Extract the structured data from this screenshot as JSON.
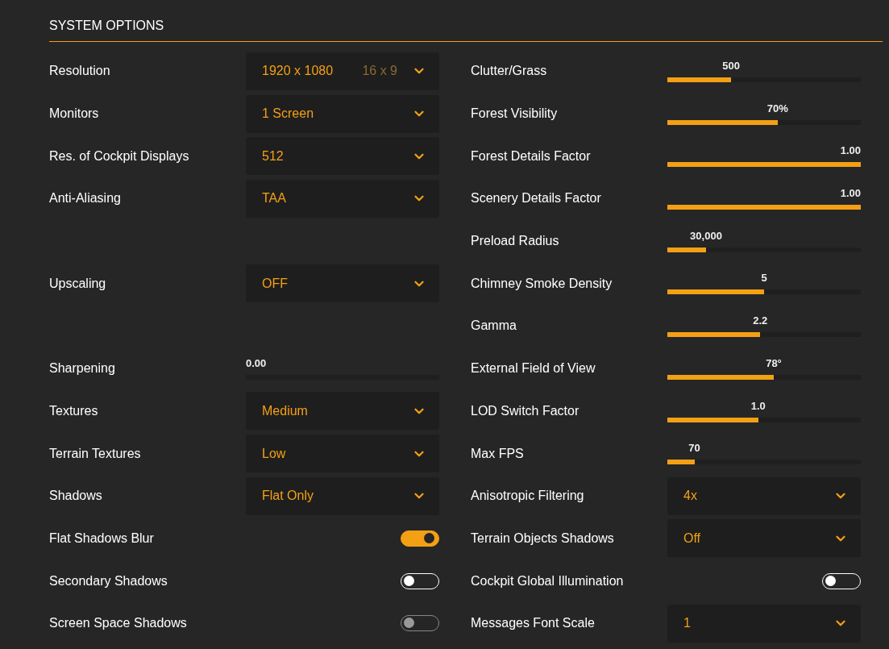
{
  "panel": {
    "title": "SYSTEM OPTIONS"
  },
  "left": [
    {
      "kind": "dropdown",
      "label": "Resolution",
      "value": "1920 x 1080",
      "hint": "16 x 9"
    },
    {
      "kind": "dropdown",
      "label": "Monitors",
      "value": "1 Screen"
    },
    {
      "kind": "dropdown",
      "label": "Res. of Cockpit Displays",
      "value": "512"
    },
    {
      "kind": "dropdown",
      "label": "Anti-Aliasing",
      "value": "TAA"
    },
    {
      "kind": "spacer"
    },
    {
      "kind": "dropdown",
      "label": "Upscaling",
      "value": "OFF"
    },
    {
      "kind": "spacer"
    },
    {
      "kind": "slider",
      "label": "Sharpening",
      "reading": "0.00",
      "level": 0
    },
    {
      "kind": "dropdown",
      "label": "Textures",
      "value": "Medium"
    },
    {
      "kind": "dropdown",
      "label": "Terrain Textures",
      "value": "Low"
    },
    {
      "kind": "dropdown",
      "label": "Shadows",
      "value": "Flat Only"
    },
    {
      "kind": "toggle",
      "label": "Flat Shadows Blur",
      "on": true,
      "disabled": false
    },
    {
      "kind": "toggle",
      "label": "Secondary Shadows",
      "on": false,
      "disabled": false
    },
    {
      "kind": "toggle",
      "label": "Screen Space Shadows",
      "on": false,
      "disabled": true
    }
  ],
  "right": [
    {
      "kind": "slider",
      "label": "Clutter/Grass",
      "reading": "500",
      "level": 0.33
    },
    {
      "kind": "slider",
      "label": "Forest Visibility",
      "reading": "70%",
      "level": 0.57
    },
    {
      "kind": "slider",
      "label": "Forest Details Factor",
      "reading": "1.00",
      "level": 1
    },
    {
      "kind": "slider",
      "label": "Scenery Details Factor",
      "reading": "1.00",
      "level": 1
    },
    {
      "kind": "slider",
      "label": "Preload Radius",
      "reading": "30,000",
      "level": 0.2
    },
    {
      "kind": "slider",
      "label": "Chimney Smoke Density",
      "reading": "5",
      "level": 0.5
    },
    {
      "kind": "slider",
      "label": "Gamma",
      "reading": "2.2",
      "level": 0.48
    },
    {
      "kind": "slider",
      "label": "External Field of View",
      "reading": "78°",
      "level": 0.55
    },
    {
      "kind": "slider",
      "label": "LOD Switch Factor",
      "reading": "1.0",
      "level": 0.47
    },
    {
      "kind": "slider",
      "label": "Max FPS",
      "reading": "70",
      "level": 0.14
    },
    {
      "kind": "dropdown",
      "label": "Anisotropic Filtering",
      "value": "4x"
    },
    {
      "kind": "dropdown",
      "label": "Terrain Objects Shadows",
      "value": "Off"
    },
    {
      "kind": "toggle",
      "label": "Cockpit Global Illumination",
      "on": false,
      "disabled": false
    },
    {
      "kind": "dropdown",
      "label": "Messages Font Scale",
      "value": "1"
    }
  ]
}
